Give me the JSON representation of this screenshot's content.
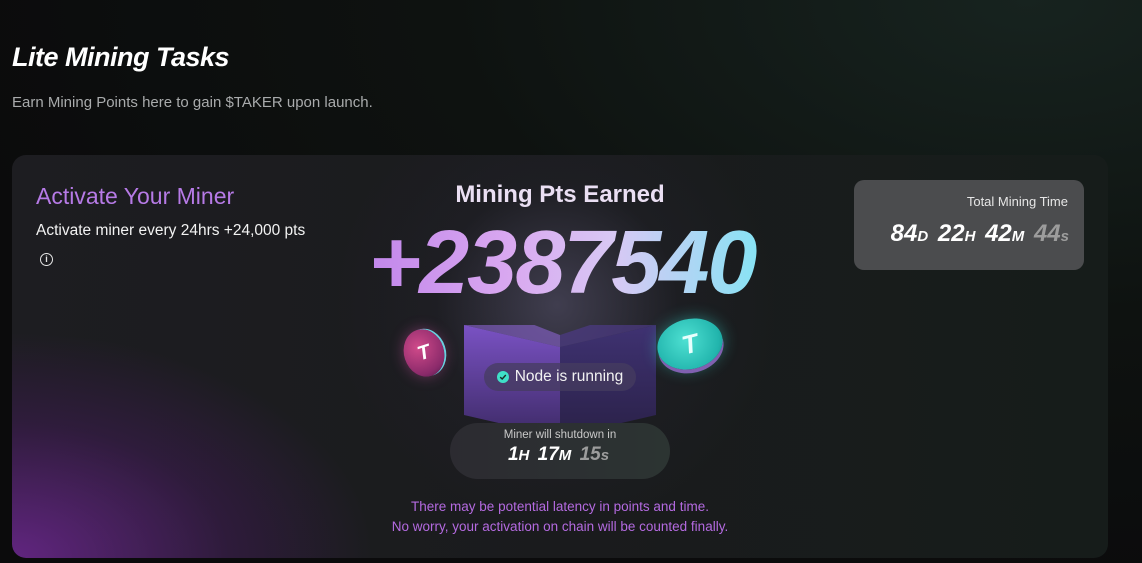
{
  "page": {
    "title": "Lite Mining Tasks",
    "subtitle": "Earn Mining Points here to gain $TAKER upon launch."
  },
  "miner": {
    "activate_title": "Activate Your Miner",
    "activate_desc": "Activate miner every 24hrs +24,000 pts",
    "mining_label": "Mining Pts Earned",
    "mining_value": "+2387540",
    "status": "Node is running",
    "shutdown_label": "Miner will shutdown in",
    "shutdown": {
      "h": "1",
      "h_unit": "H",
      "m": "17",
      "m_unit": "M",
      "s": "15",
      "s_unit": "s"
    },
    "total_label": "Total Mining Time",
    "total": {
      "d": "84",
      "d_unit": "D",
      "h": "22",
      "h_unit": "H",
      "m": "42",
      "m_unit": "M",
      "s": "44",
      "s_unit": "s"
    },
    "notice_line1": "There may be potential latency in points and time.",
    "notice_line2": "No worry, your activation on chain will be counted finally."
  },
  "icons": [
    "info-icon",
    "check-icon",
    "taker-coin-icon"
  ],
  "colors": {
    "accent_purple": "#b67ae6",
    "accent_teal": "#3fe0c8"
  }
}
